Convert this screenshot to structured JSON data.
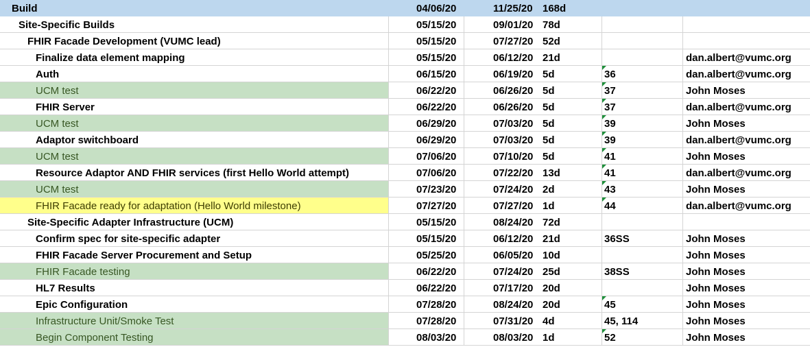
{
  "header": {
    "task": "Build",
    "start": "04/06/20",
    "end": "11/25/20",
    "duration": "168d"
  },
  "rows": [
    {
      "task": "Site-Specific Builds",
      "level": 1,
      "fill": "none",
      "bold": true,
      "start": "05/15/20",
      "end": "09/01/20",
      "duration": "78d",
      "pred": "",
      "flag": false,
      "resource": ""
    },
    {
      "task": "FHIR Facade Development (VUMC lead)",
      "level": 2,
      "fill": "none",
      "bold": true,
      "start": "05/15/20",
      "end": "07/27/20",
      "duration": "52d",
      "pred": "",
      "flag": false,
      "resource": ""
    },
    {
      "task": "Finalize data element mapping",
      "level": 3,
      "fill": "none",
      "bold": true,
      "start": "05/15/20",
      "end": "06/12/20",
      "duration": "21d",
      "pred": "",
      "flag": false,
      "resource": "dan.albert@vumc.org"
    },
    {
      "task": "Auth",
      "level": 3,
      "fill": "none",
      "bold": true,
      "start": "06/15/20",
      "end": "06/19/20",
      "duration": "5d",
      "pred": "36",
      "flag": true,
      "resource": "dan.albert@vumc.org"
    },
    {
      "task": "UCM test",
      "level": 3,
      "fill": "green",
      "bold": false,
      "start": "06/22/20",
      "end": "06/26/20",
      "duration": "5d",
      "pred": "37",
      "flag": true,
      "resource": "John Moses"
    },
    {
      "task": "FHIR Server",
      "level": 3,
      "fill": "none",
      "bold": true,
      "start": "06/22/20",
      "end": "06/26/20",
      "duration": "5d",
      "pred": "37",
      "flag": true,
      "resource": "dan.albert@vumc.org"
    },
    {
      "task": "UCM test",
      "level": 3,
      "fill": "green",
      "bold": false,
      "start": "06/29/20",
      "end": "07/03/20",
      "duration": "5d",
      "pred": "39",
      "flag": true,
      "resource": "John Moses"
    },
    {
      "task": "Adaptor switchboard",
      "level": 3,
      "fill": "none",
      "bold": true,
      "start": "06/29/20",
      "end": "07/03/20",
      "duration": "5d",
      "pred": "39",
      "flag": true,
      "resource": "dan.albert@vumc.org"
    },
    {
      "task": "UCM test",
      "level": 3,
      "fill": "green",
      "bold": false,
      "start": "07/06/20",
      "end": "07/10/20",
      "duration": "5d",
      "pred": "41",
      "flag": true,
      "resource": "John Moses"
    },
    {
      "task": "Resource Adaptor AND FHIR services (first Hello World attempt)",
      "level": 3,
      "fill": "none",
      "bold": true,
      "start": "07/06/20",
      "end": "07/22/20",
      "duration": "13d",
      "pred": "41",
      "flag": true,
      "resource": "dan.albert@vumc.org"
    },
    {
      "task": "UCM test",
      "level": 3,
      "fill": "green",
      "bold": false,
      "start": "07/23/20",
      "end": "07/24/20",
      "duration": "2d",
      "pred": "43",
      "flag": true,
      "resource": "John Moses"
    },
    {
      "task": "FHIR Facade ready for adaptation (Hello World milestone)",
      "level": 3,
      "fill": "yellow",
      "bold": false,
      "start": "07/27/20",
      "end": "07/27/20",
      "duration": "1d",
      "pred": "44",
      "flag": true,
      "resource": "dan.albert@vumc.org"
    },
    {
      "task": "Site-Specific Adapter Infrastructure (UCM)",
      "level": 2,
      "fill": "none",
      "bold": true,
      "start": "05/15/20",
      "end": "08/24/20",
      "duration": "72d",
      "pred": "",
      "flag": false,
      "resource": ""
    },
    {
      "task": "Confirm spec for site-specific adapter",
      "level": 3,
      "fill": "none",
      "bold": true,
      "start": "05/15/20",
      "end": "06/12/20",
      "duration": "21d",
      "pred": "36SS",
      "flag": false,
      "resource": "John Moses"
    },
    {
      "task": "FHIR Facade Server Procurement and Setup",
      "level": 3,
      "fill": "none",
      "bold": true,
      "start": "05/25/20",
      "end": "06/05/20",
      "duration": "10d",
      "pred": "",
      "flag": false,
      "resource": "John Moses"
    },
    {
      "task": "FHIR Facade testing",
      "level": 3,
      "fill": "green",
      "bold": false,
      "start": "06/22/20",
      "end": "07/24/20",
      "duration": "25d",
      "pred": "38SS",
      "flag": false,
      "resource": "John Moses"
    },
    {
      "task": "HL7 Results",
      "level": 3,
      "fill": "none",
      "bold": true,
      "start": "06/22/20",
      "end": "07/17/20",
      "duration": "20d",
      "pred": "",
      "flag": false,
      "resource": "John Moses"
    },
    {
      "task": "Epic Configuration",
      "level": 3,
      "fill": "none",
      "bold": true,
      "start": "07/28/20",
      "end": "08/24/20",
      "duration": "20d",
      "pred": "45",
      "flag": true,
      "resource": "John Moses"
    },
    {
      "task": "Infrastructure Unit/Smoke Test",
      "level": 3,
      "fill": "green",
      "bold": false,
      "start": "07/28/20",
      "end": "07/31/20",
      "duration": "4d",
      "pred": "45, 114",
      "flag": false,
      "resource": "John Moses"
    },
    {
      "task": "Begin Component Testing",
      "level": 3,
      "fill": "green",
      "bold": false,
      "start": "08/03/20",
      "end": "08/03/20",
      "duration": "1d",
      "pred": "52",
      "flag": true,
      "resource": "John Moses"
    }
  ]
}
